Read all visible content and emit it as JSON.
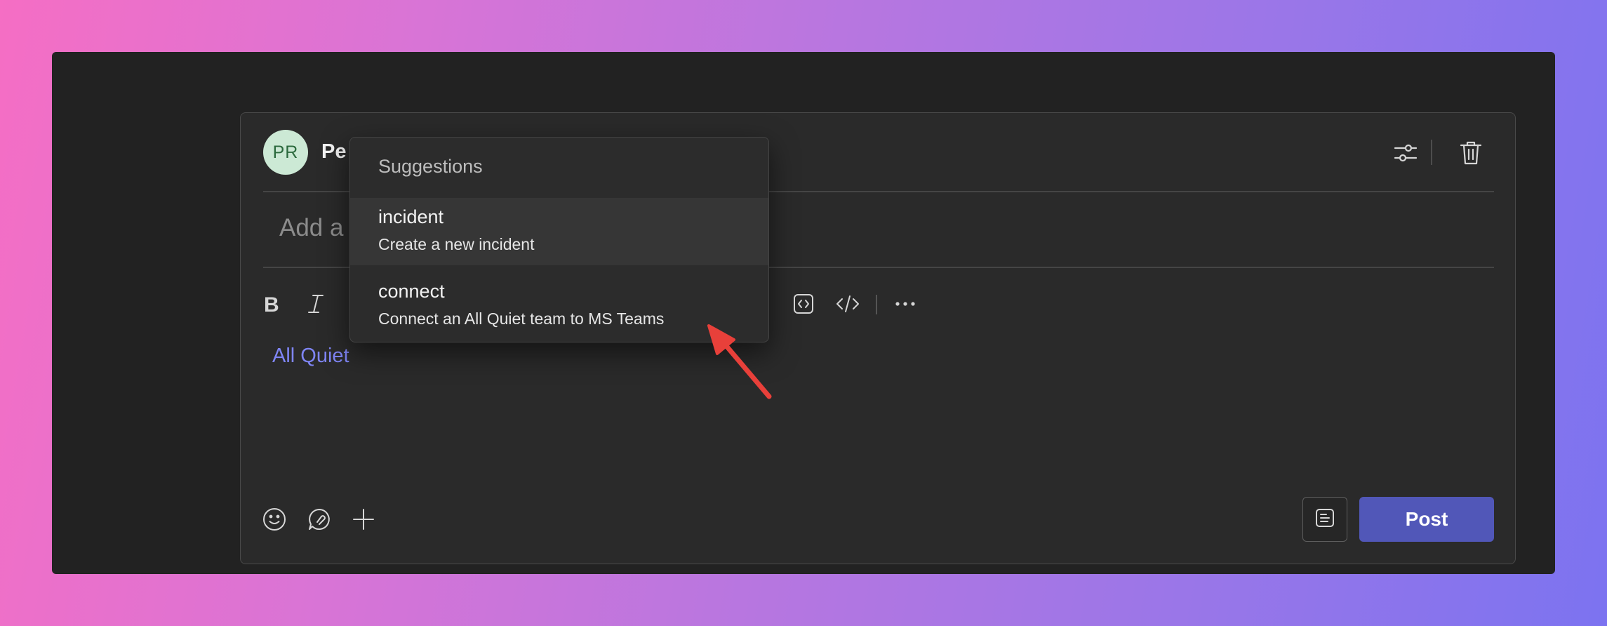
{
  "compose": {
    "avatar_initials": "PR",
    "sender_name": "Pe",
    "subject_placeholder": "Add a",
    "mention": "All Quiet",
    "post_label": "Post"
  },
  "header_icons": [
    "options-sliders-icon",
    "trash-icon"
  ],
  "toolbar_icons": [
    "bold-icon",
    "italic-icon",
    "code-snippet-icon",
    "code-icon",
    "more-options-icon"
  ],
  "footer_icons": [
    "emoji-icon",
    "loop-component-icon",
    "add-icon",
    "format-icon"
  ],
  "suggestions": {
    "title": "Suggestions",
    "items": [
      {
        "command": "incident",
        "description": "Create a new incident"
      },
      {
        "command": "connect",
        "description": "Connect an All Quiet team to MS Teams"
      }
    ]
  },
  "colors": {
    "accent": "#5157b8",
    "mention": "#7f85f5",
    "arrow": "#e8403a",
    "avatar_bg": "#cce9d5",
    "avatar_text": "#2c6a3e"
  }
}
